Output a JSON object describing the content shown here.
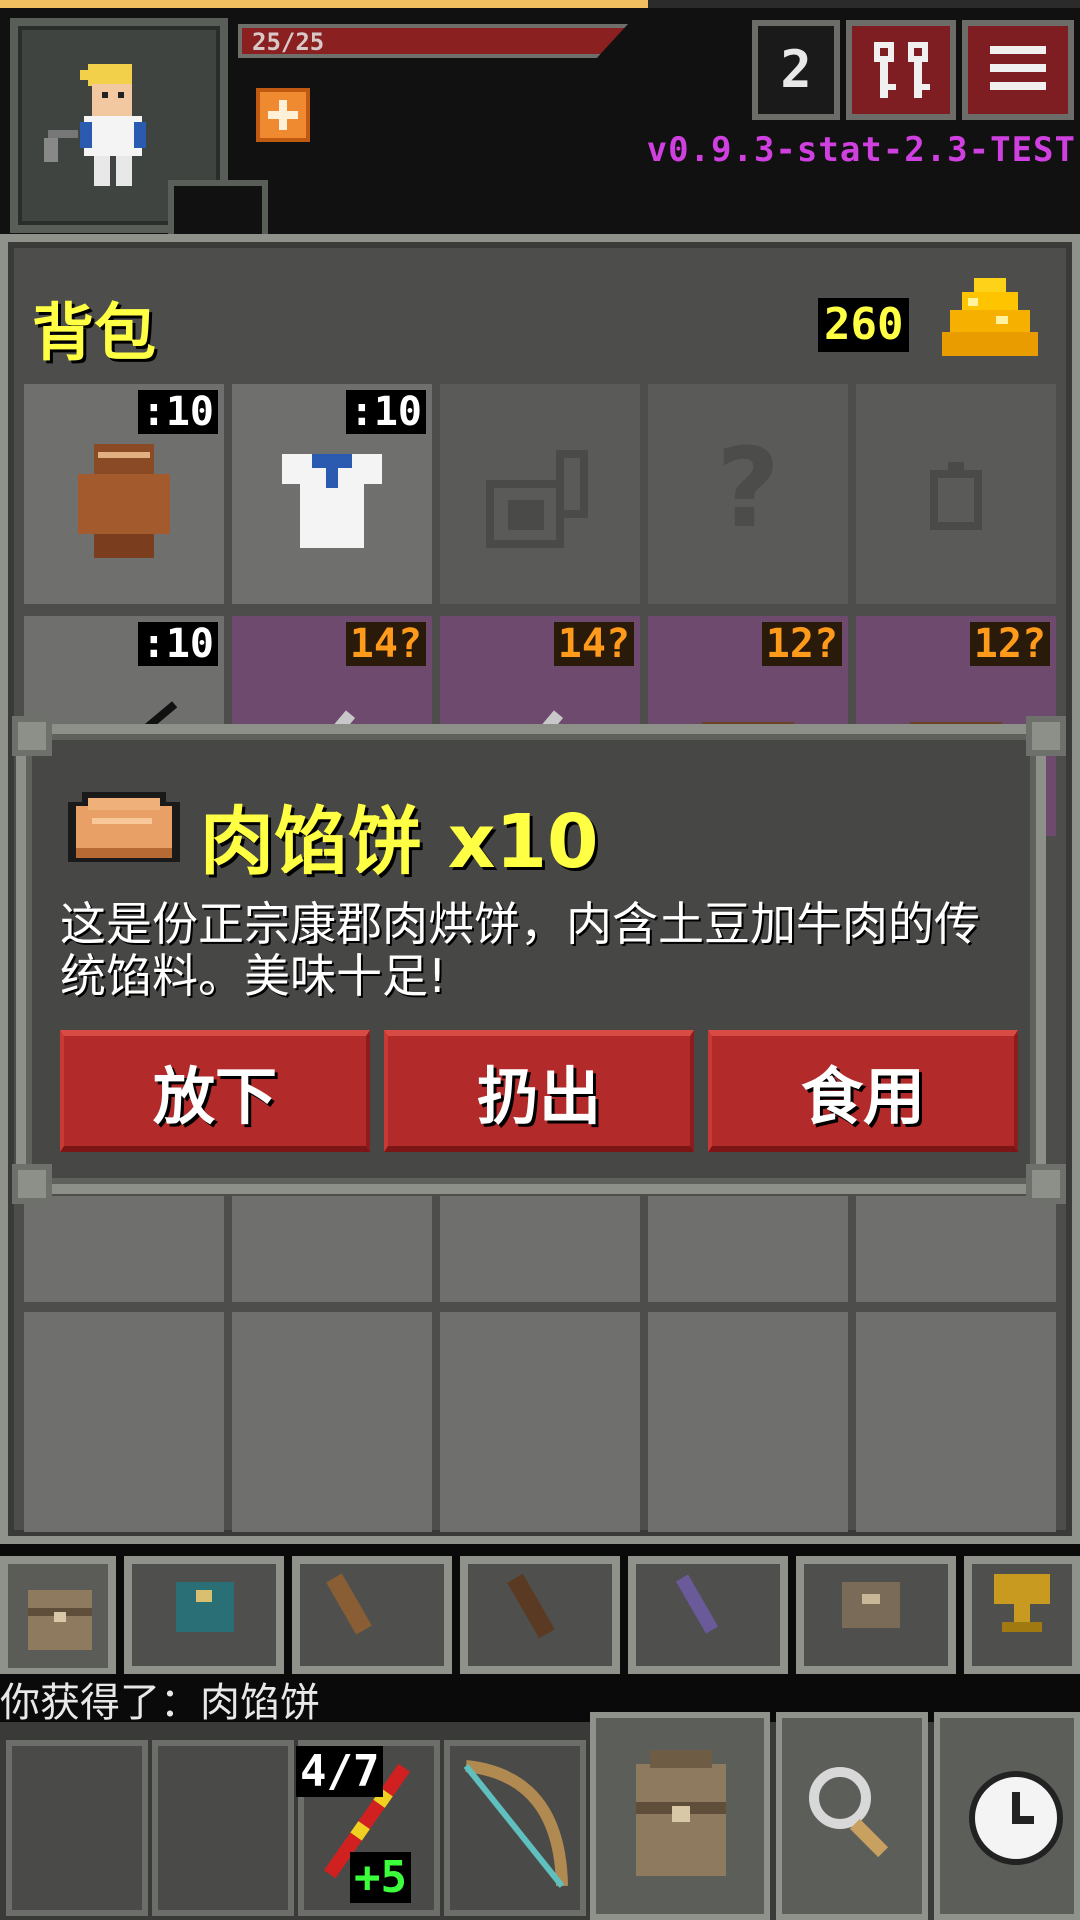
{
  "hud": {
    "hp_text": "25/25",
    "depth": "2",
    "keys_icon": "keys-icon",
    "menu_icon": "menu-icon",
    "version": "v0.9.3-stat-2.3-TEST",
    "buff_icon": "healing-buff-icon",
    "xp_progress": 0.6,
    "hp_progress": 1.0
  },
  "backpack": {
    "title": "背包",
    "gold": "260",
    "rows": [
      [
        {
          "icon": "gloves-icon",
          "count": ":10"
        },
        {
          "icon": "cloth-armor-icon",
          "count": ":10"
        },
        {
          "icon": "empty-artifact-slot-icon",
          "count": ""
        },
        {
          "icon": "empty-misc-slot-icon",
          "count": ""
        },
        {
          "icon": "empty-ring-slot-icon",
          "count": ""
        }
      ],
      [
        {
          "icon": "dart-icon",
          "count": ":10"
        },
        {
          "icon": "sword-icon",
          "count": "14?"
        },
        {
          "icon": "sword-icon",
          "count": "14?"
        },
        {
          "icon": "leather-armor-icon",
          "count": "12?"
        },
        {
          "icon": "leather-armor-icon",
          "count": "12?"
        }
      ]
    ]
  },
  "item_dialog": {
    "icon": "meat-pie-icon",
    "title": "肉馅饼 x10",
    "description": "这是份正宗康郡肉烘饼，内含土豆加牛肉的传统馅料。美味十足!",
    "actions": [
      "放下",
      "扔出",
      "食用"
    ]
  },
  "tabs": [
    {
      "icon": "backpack-tab-icon"
    },
    {
      "icon": "seed-pouch-tab-icon"
    },
    {
      "icon": "scroll-holder-tab-icon"
    },
    {
      "icon": "wand-holster-tab-icon"
    },
    {
      "icon": "potion-bandolier-tab-icon"
    },
    {
      "icon": "velvet-pouch-tab-icon"
    },
    {
      "icon": "trophy-tab-icon"
    }
  ],
  "log": {
    "text": "你获得了：肉馅饼"
  },
  "toolbar": {
    "quickslot_charge": "4/7",
    "quickslot_bonus": "+5",
    "buttons": [
      "backpack-icon",
      "search-icon",
      "wait-clock-icon"
    ]
  },
  "colors": {
    "accent_yellow": "#ffff44",
    "button_red": "#b22a2a",
    "version_magenta": "#d040e0",
    "unidentified_purple": "#6e4a6e"
  }
}
